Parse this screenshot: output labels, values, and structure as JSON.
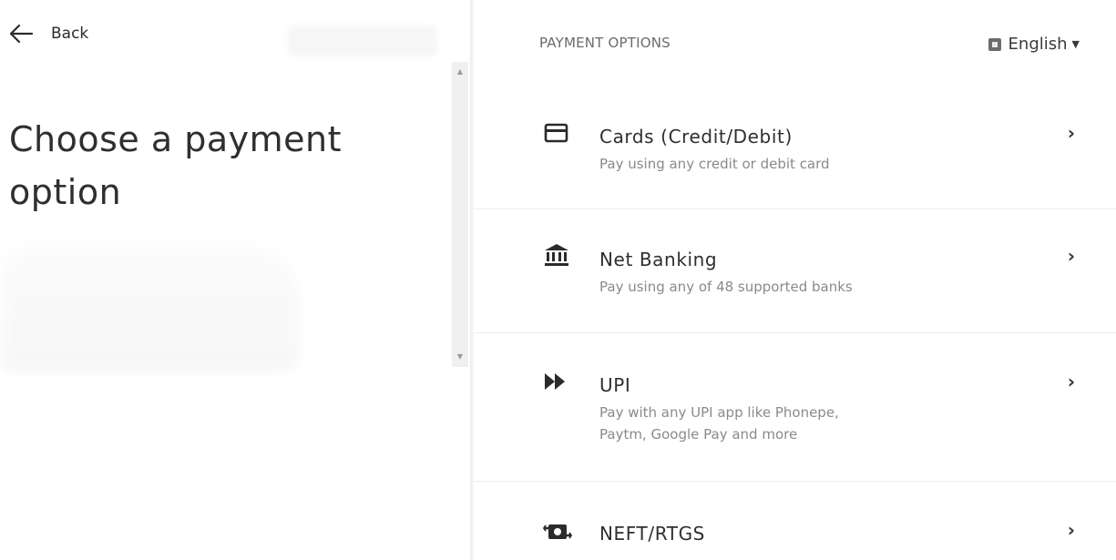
{
  "back": {
    "label": "Back"
  },
  "left": {
    "heading": "Choose a payment option"
  },
  "right": {
    "section_title": "PAYMENT OPTIONS",
    "language": "English"
  },
  "options": [
    {
      "title": "Cards (Credit/Debit)",
      "subtitle": "Pay using any credit or debit card",
      "icon": "card-icon"
    },
    {
      "title": "Net Banking",
      "subtitle": "Pay using any of 48 supported banks",
      "icon": "bank-icon"
    },
    {
      "title": "UPI",
      "subtitle_line1": "Pay with any UPI app like Phonepe,",
      "subtitle_line2": "Paytm, Google Pay and more",
      "icon": "fast-forward-icon"
    },
    {
      "title": "NEFT/RTGS",
      "icon": "transfer-icon"
    }
  ],
  "chevron": "›",
  "colors": {
    "text": "#2f2f2f",
    "muted": "#8a8a8a",
    "divider": "#ececec"
  }
}
